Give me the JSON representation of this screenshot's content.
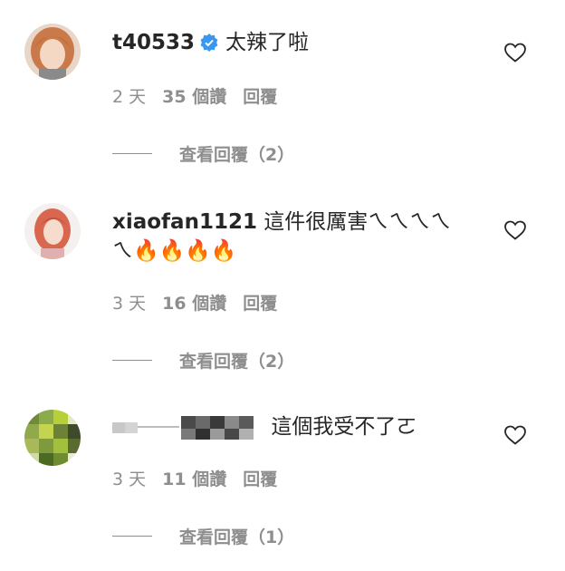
{
  "comments": [
    {
      "username": "t40533",
      "text": "太辣了啦",
      "verified": true,
      "time": "2 天",
      "likes": "35 個讚",
      "reply": "回覆",
      "view_replies": "查看回覆（2）"
    },
    {
      "username": "xiaofan1121",
      "text_line1": "這件很厲害ㄟㄟㄟㄟ",
      "text_line2": "ㄟ🔥🔥🔥🔥",
      "time": "3 天",
      "likes": "16 個讚",
      "reply": "回覆",
      "view_replies": "查看回覆（2）"
    },
    {
      "username": "",
      "text": "這個我受不了ㄛ",
      "time": "3 天",
      "likes": "11 個讚",
      "reply": "回覆",
      "view_replies": "查看回覆（1）"
    }
  ],
  "icons": {
    "like": "heart-outline-icon",
    "verified": "verified-badge-icon"
  },
  "colors": {
    "verified": "#3897f0",
    "secondary_text": "#8e8e8e",
    "fire": "#f26522"
  }
}
